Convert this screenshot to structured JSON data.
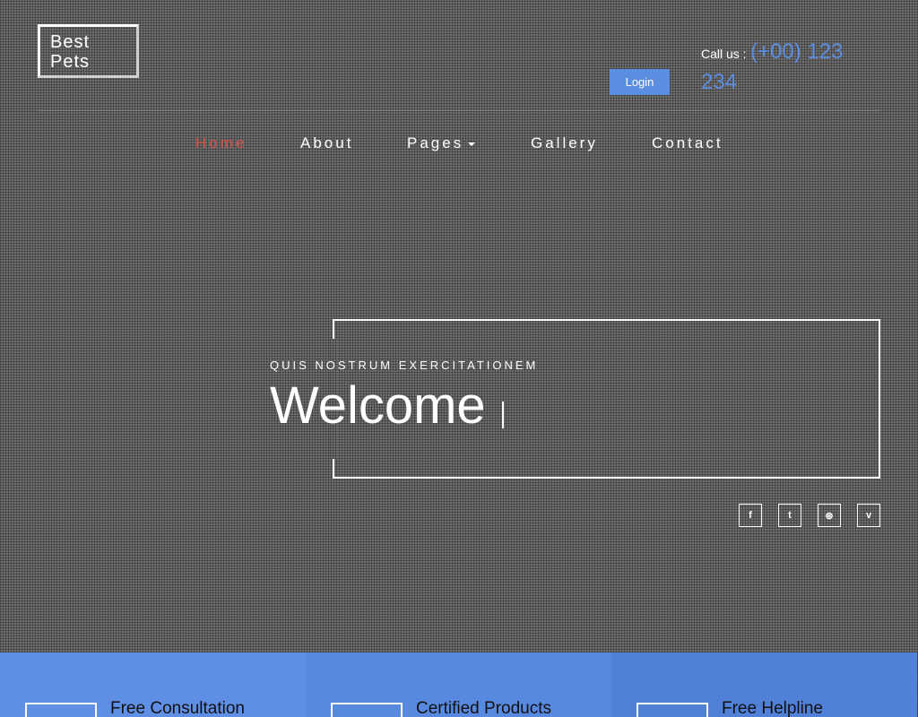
{
  "logo": {
    "line1": "Best",
    "line2": "Pets"
  },
  "header": {
    "login_label": "Login",
    "call_label": "Call us :",
    "call_number": "(+00) 123 234"
  },
  "nav": {
    "items": [
      {
        "label": "Home",
        "active": true
      },
      {
        "label": "About"
      },
      {
        "label": "Pages",
        "dropdown": true
      },
      {
        "label": "Gallery"
      },
      {
        "label": "Contact"
      }
    ]
  },
  "hero": {
    "subtitle": "QUIS NOSTRUM EXERCITATIONEM",
    "title": "Welcome"
  },
  "social": [
    {
      "icon": "facebook-icon",
      "glyph": "f"
    },
    {
      "icon": "twitter-icon",
      "glyph": "t"
    },
    {
      "icon": "dribbble-icon",
      "glyph": "⊛"
    },
    {
      "icon": "vimeo-icon",
      "glyph": "v"
    }
  ],
  "features": [
    {
      "title": "Free Consultation",
      "color": "#5f8fe4"
    },
    {
      "title": "Certified Products",
      "color": "#5789e0"
    },
    {
      "title": "Free Helpline",
      "color": "#5080d8"
    }
  ],
  "colors": {
    "accent": "#5b8ee0",
    "active_nav": "#d9504a",
    "background": "#6e6e6e"
  }
}
